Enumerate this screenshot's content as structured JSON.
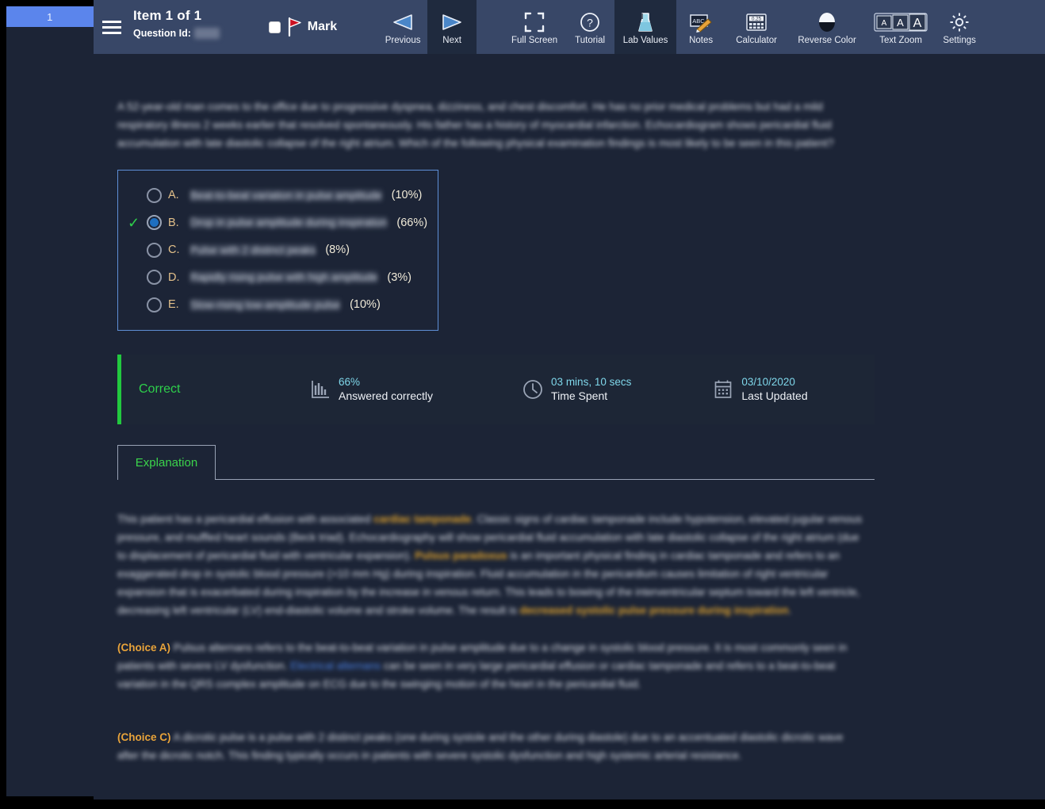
{
  "sidebar": {
    "tabs": [
      {
        "label": "1"
      }
    ]
  },
  "toolbar": {
    "menu_icon": "hamburger-icon",
    "item_counter": "Item 1 of 1",
    "question_id_label": "Question Id:",
    "question_id_value": "9999",
    "mark_label": "Mark",
    "buttons": [
      {
        "label": "Previous",
        "icon": "previous-triangle-icon",
        "active": false
      },
      {
        "label": "Next",
        "icon": "next-triangle-icon",
        "active": true
      },
      {
        "label": "Full Screen",
        "icon": "fullscreen-icon",
        "active": false
      },
      {
        "label": "Tutorial",
        "icon": "question-mark-icon",
        "active": false
      },
      {
        "label": "Lab Values",
        "icon": "flask-icon",
        "active": true
      },
      {
        "label": "Notes",
        "icon": "notes-pencil-icon",
        "active": false
      },
      {
        "label": "Calculator",
        "icon": "calculator-icon",
        "active": false
      },
      {
        "label": "Reverse Color",
        "icon": "contrast-circle-icon",
        "active": false
      },
      {
        "label": "Text Zoom",
        "icon": "text-zoom-icon",
        "active": false
      },
      {
        "label": "Settings",
        "icon": "gear-icon",
        "active": false
      }
    ],
    "calculator_display": "0.25",
    "text_zoom_sizes": [
      "A",
      "A",
      "A"
    ]
  },
  "question": {
    "stem": "A 52-year-old man comes to the office due to progressive dyspnea, dizziness, and chest discomfort.  He has no prior medical problems but had a mild respiratory illness 2 weeks earlier that resolved spontaneously.  His father has a history of myocardial infarction.  Echocardiogram shows pericardial fluid accumulation with late diastolic collapse of the right atrium.  Which of the following physical examination findings is most likely to be seen in this patient?",
    "choices": [
      {
        "letter": "A.",
        "text": "Beat-to-beat variation in pulse amplitude",
        "percent": "(10%)",
        "selected": false,
        "correct": false
      },
      {
        "letter": "B.",
        "text": "Drop in pulse amplitude during inspiration",
        "percent": "(66%)",
        "selected": true,
        "correct": true
      },
      {
        "letter": "C.",
        "text": "Pulse with 2 distinct peaks",
        "percent": "(8%)",
        "selected": false,
        "correct": false
      },
      {
        "letter": "D.",
        "text": "Rapidly rising pulse with high amplitude",
        "percent": "(3%)",
        "selected": false,
        "correct": false
      },
      {
        "letter": "E.",
        "text": "Slow-rising low-amplitude pulse",
        "percent": "(10%)",
        "selected": false,
        "correct": false
      }
    ]
  },
  "stats": {
    "result": "Correct",
    "percent_value": "66%",
    "percent_label": "Answered correctly",
    "time_value": "03 mins, 10 secs",
    "time_label": "Time Spent",
    "updated_value": "03/10/2020",
    "updated_label": "Last Updated"
  },
  "tabs": {
    "explanation": "Explanation"
  },
  "explanation": {
    "main_paragraph_parts": [
      {
        "t": "This patient has a pericardial effusion with associated ",
        "s": "plain"
      },
      {
        "t": "cardiac tamponade",
        "s": "orange"
      },
      {
        "t": ".  Classic signs of cardiac tamponade include hypotension, elevated jugular venous pressure, and muffled heart sounds (Beck triad).  Echocardiography will show pericardial fluid accumulation with late diastolic collapse of the right atrium (due to displacement of pericardial fluid with ventricular expansion).  ",
        "s": "plain"
      },
      {
        "t": "Pulsus paradoxus",
        "s": "orange"
      },
      {
        "t": " is an important physical finding in cardiac tamponade and refers to an exaggerated drop in systolic blood pressure (>10 mm Hg) during inspiration.  Fluid accumulation in the pericardium causes limitation of right ventricular expansion that is exacerbated during inspiration by the increase in venous return.  This leads to bowing of the interventricular septum toward the left ventricle, decreasing left ventricular (LV) end-diastolic volume and stroke volume.  The result is ",
        "s": "plain"
      },
      {
        "t": "decreased systolic pulse pressure during inspiration",
        "s": "orange"
      },
      {
        "t": ".",
        "s": "plain"
      }
    ],
    "choice_a_label": "(Choice A)",
    "choice_a_parts": [
      {
        "t": " Pulsus alternans refers to the beat-to-beat variation in pulse amplitude due to a change in systolic blood pressure. It is most commonly seen in patients with severe LV dysfunction.  ",
        "s": "plain"
      },
      {
        "t": "Electrical alternans",
        "s": "blue"
      },
      {
        "t": " can be seen in very large pericardial effusion or cardiac tamponade and refers to a beat-to-beat variation in the QRS complex amplitude on ECG due to the swinging motion of the heart in the pericardial fluid.",
        "s": "plain"
      }
    ],
    "choice_c_label": "(Choice C)",
    "choice_c_parts": [
      {
        "t": " A dicrotic pulse is a pulse with 2 distinct peaks (one during systole and the other during diastole) due to an accentuated diastolic dicrotic wave after the dicrotic notch.  This finding typically occurs in patients with severe systolic dysfunction and high systemic arterial resistance.",
        "s": "plain"
      }
    ]
  },
  "colors": {
    "header_bg": "#384767",
    "page_bg": "#1c2436",
    "accent_blue": "#5b85ec",
    "correct_green": "#2ecf4b",
    "highlight_orange": "#e0a32e",
    "link_blue": "#4a7fe0",
    "stat_value_blue": "#7fd7ea",
    "choice_letter": "#e3c08a"
  }
}
